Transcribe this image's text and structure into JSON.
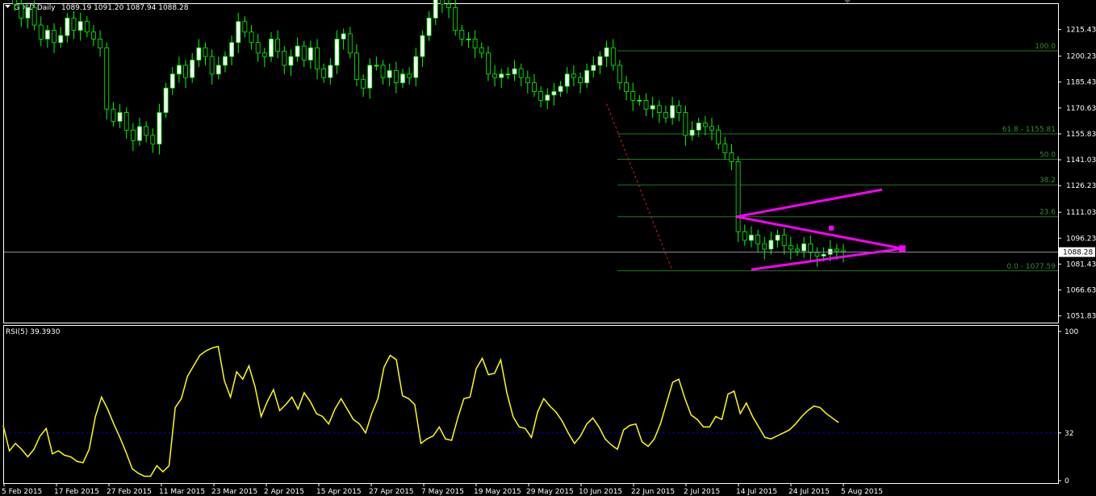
{
  "header": {
    "menu_icon": "triangle-down-icon",
    "symbol": "GOLD,Daily",
    "ohlc": "1089.19 1091.20 1087.94 1088.28"
  },
  "chart_data": [
    {
      "type": "candlestick",
      "title": "GOLD,Daily",
      "colors": {
        "bull": "#ffffff",
        "bear": "#000000",
        "wick": "#00ff00",
        "background": "#000000",
        "grid": "#2e2e2e",
        "axis": "#ffffff"
      },
      "ylim": [
        1048,
        1230
      ],
      "y_ticks": [
        "1215.43",
        "1200.23",
        "1185.43",
        "1170.63",
        "1155.83",
        "1141.03",
        "1126.23",
        "1111.03",
        "1096.23",
        "1081.43",
        "1066.63",
        "1051.83"
      ],
      "y_tick_values": [
        1215.43,
        1200.23,
        1185.43,
        1170.63,
        1155.83,
        1141.03,
        1126.23,
        1111.03,
        1096.23,
        1081.43,
        1066.63,
        1051.83
      ],
      "current_price": "1088.28",
      "current_price_value": 1088.28,
      "x_labels": [
        "5 Feb 2015",
        "17 Feb 2015",
        "27 Feb 2015",
        "11 Mar 2015",
        "23 Mar 2015",
        "2 Apr 2015",
        "15 Apr 2015",
        "27 Apr 2015",
        "7 May 2015",
        "19 May 2015",
        "29 May 2015",
        "10 Jun 2015",
        "22 Jun 2015",
        "2 Jul 2015",
        "14 Jul 2015",
        "24 Jul 2015",
        "5 Aug 2015"
      ],
      "closes": [
        1235,
        1230,
        1222,
        1228,
        1218,
        1210,
        1215,
        1208,
        1212,
        1222,
        1215,
        1220,
        1214,
        1210,
        1205,
        1170,
        1163,
        1168,
        1158,
        1152,
        1160,
        1155,
        1150,
        1168,
        1182,
        1190,
        1195,
        1188,
        1198,
        1205,
        1200,
        1190,
        1195,
        1200,
        1208,
        1220,
        1214,
        1208,
        1202,
        1200,
        1210,
        1203,
        1195,
        1200,
        1206,
        1198,
        1205,
        1193,
        1188,
        1195,
        1210,
        1213,
        1202,
        1187,
        1182,
        1195,
        1195,
        1188,
        1192,
        1185,
        1190,
        1188,
        1200,
        1212,
        1222,
        1235,
        1230,
        1228,
        1215,
        1210,
        1210,
        1205,
        1202,
        1190,
        1188,
        1190,
        1190,
        1193,
        1188,
        1185,
        1180,
        1175,
        1178,
        1180,
        1183,
        1190,
        1188,
        1185,
        1192,
        1195,
        1200,
        1205,
        1195,
        1185,
        1180,
        1175,
        1175,
        1170,
        1172,
        1168,
        1165,
        1172,
        1168,
        1155,
        1158,
        1162,
        1160,
        1158,
        1150,
        1145,
        1140,
        1100,
        1095,
        1098,
        1093,
        1090,
        1095,
        1098,
        1092,
        1090,
        1089,
        1093,
        1088,
        1086,
        1087,
        1090,
        1089,
        1088.28
      ],
      "fibonacci": {
        "levels": [
          {
            "label": "100.0",
            "value": 1203.3
          },
          {
            "label": "61.8 - 1155.81",
            "value": 1155.81
          },
          {
            "label": "50.0",
            "value": 1141.3
          },
          {
            "label": "38.2",
            "value": 1126.7
          },
          {
            "label": "23.6",
            "value": 1108.5
          },
          {
            "label": "0.0 - 1077.59",
            "value": 1077.59
          }
        ]
      },
      "trendline_style": "red dashed"
    },
    {
      "type": "line",
      "title": "RSI(5) 39.3930",
      "color": "#ffff00",
      "ylim": [
        0,
        100
      ],
      "y_ticks": [
        "100",
        "32",
        "0"
      ],
      "y_tick_values": [
        100,
        32,
        0
      ],
      "level_line": 32,
      "level_color": "#0000cc",
      "values": [
        37,
        20,
        25,
        21,
        16,
        21,
        30,
        35,
        18,
        20,
        17,
        16,
        13,
        12,
        21,
        43,
        56,
        48,
        38,
        29,
        19,
        8,
        5,
        3,
        3,
        10,
        6,
        10,
        49,
        55,
        70,
        77,
        84,
        87,
        89,
        90,
        67,
        56,
        73,
        68,
        77,
        63,
        43,
        53,
        61,
        47,
        51,
        56,
        48,
        59,
        53,
        45,
        43,
        38,
        48,
        55,
        48,
        41,
        38,
        32,
        45,
        55,
        76,
        84,
        81,
        57,
        55,
        51,
        25,
        28,
        30,
        36,
        28,
        27,
        42,
        55,
        56,
        75,
        82,
        71,
        72,
        81,
        59,
        43,
        36,
        35,
        29,
        46,
        55,
        50,
        46,
        40,
        32,
        25,
        30,
        38,
        42,
        36,
        28,
        24,
        21,
        34,
        37,
        38,
        26,
        23,
        28,
        38,
        52,
        66,
        68,
        55,
        44,
        41,
        36,
        36,
        43,
        41,
        58,
        60,
        45,
        52,
        43,
        36,
        29,
        28,
        30,
        32,
        34,
        38,
        43,
        47,
        50,
        49,
        45,
        42,
        39
      ]
    }
  ],
  "rsi_title": "RSI(5) 39.3930"
}
